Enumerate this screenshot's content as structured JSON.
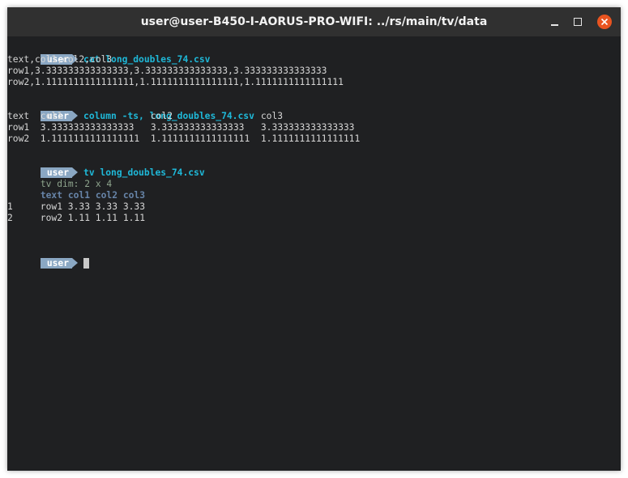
{
  "window": {
    "title": "user@user-B450-I-AORUS-PRO-WIFI: ../rs/main/tv/data",
    "icons": {
      "minimize": "minimize-icon",
      "maximize": "maximize-icon",
      "close": "close-icon"
    },
    "colors": {
      "close_button": "#e95420",
      "background": "#1f2022",
      "titlebar": "#303030"
    }
  },
  "prompt": {
    "label": "user",
    "color": "#8aa7c3"
  },
  "commands": {
    "cat": {
      "command": "cat long_doubles_74.csv",
      "output": [
        "text,col1,col2,col3",
        "row1,3.333333333333333,3.333333333333333,3.333333333333333",
        "row2,1.1111111111111111,1.1111111111111111,1.1111111111111111"
      ]
    },
    "column": {
      "command": "column -ts, long_doubles_74.csv",
      "output": [
        "text  col1                col2                col3",
        "row1  3.333333333333333   3.333333333333333   3.333333333333333",
        "row2  1.1111111111111111  1.1111111111111111  1.1111111111111111"
      ]
    },
    "tv": {
      "command": "tv long_doubles_74.csv",
      "dim": "tv dim: 2 x 4",
      "header": "text col1 col2 col3",
      "rows": [
        {
          "index": "1",
          "text": "row1 3.33 3.33 3.33"
        },
        {
          "index": "2",
          "text": "row2 1.11 1.11 1.11"
        }
      ]
    }
  }
}
